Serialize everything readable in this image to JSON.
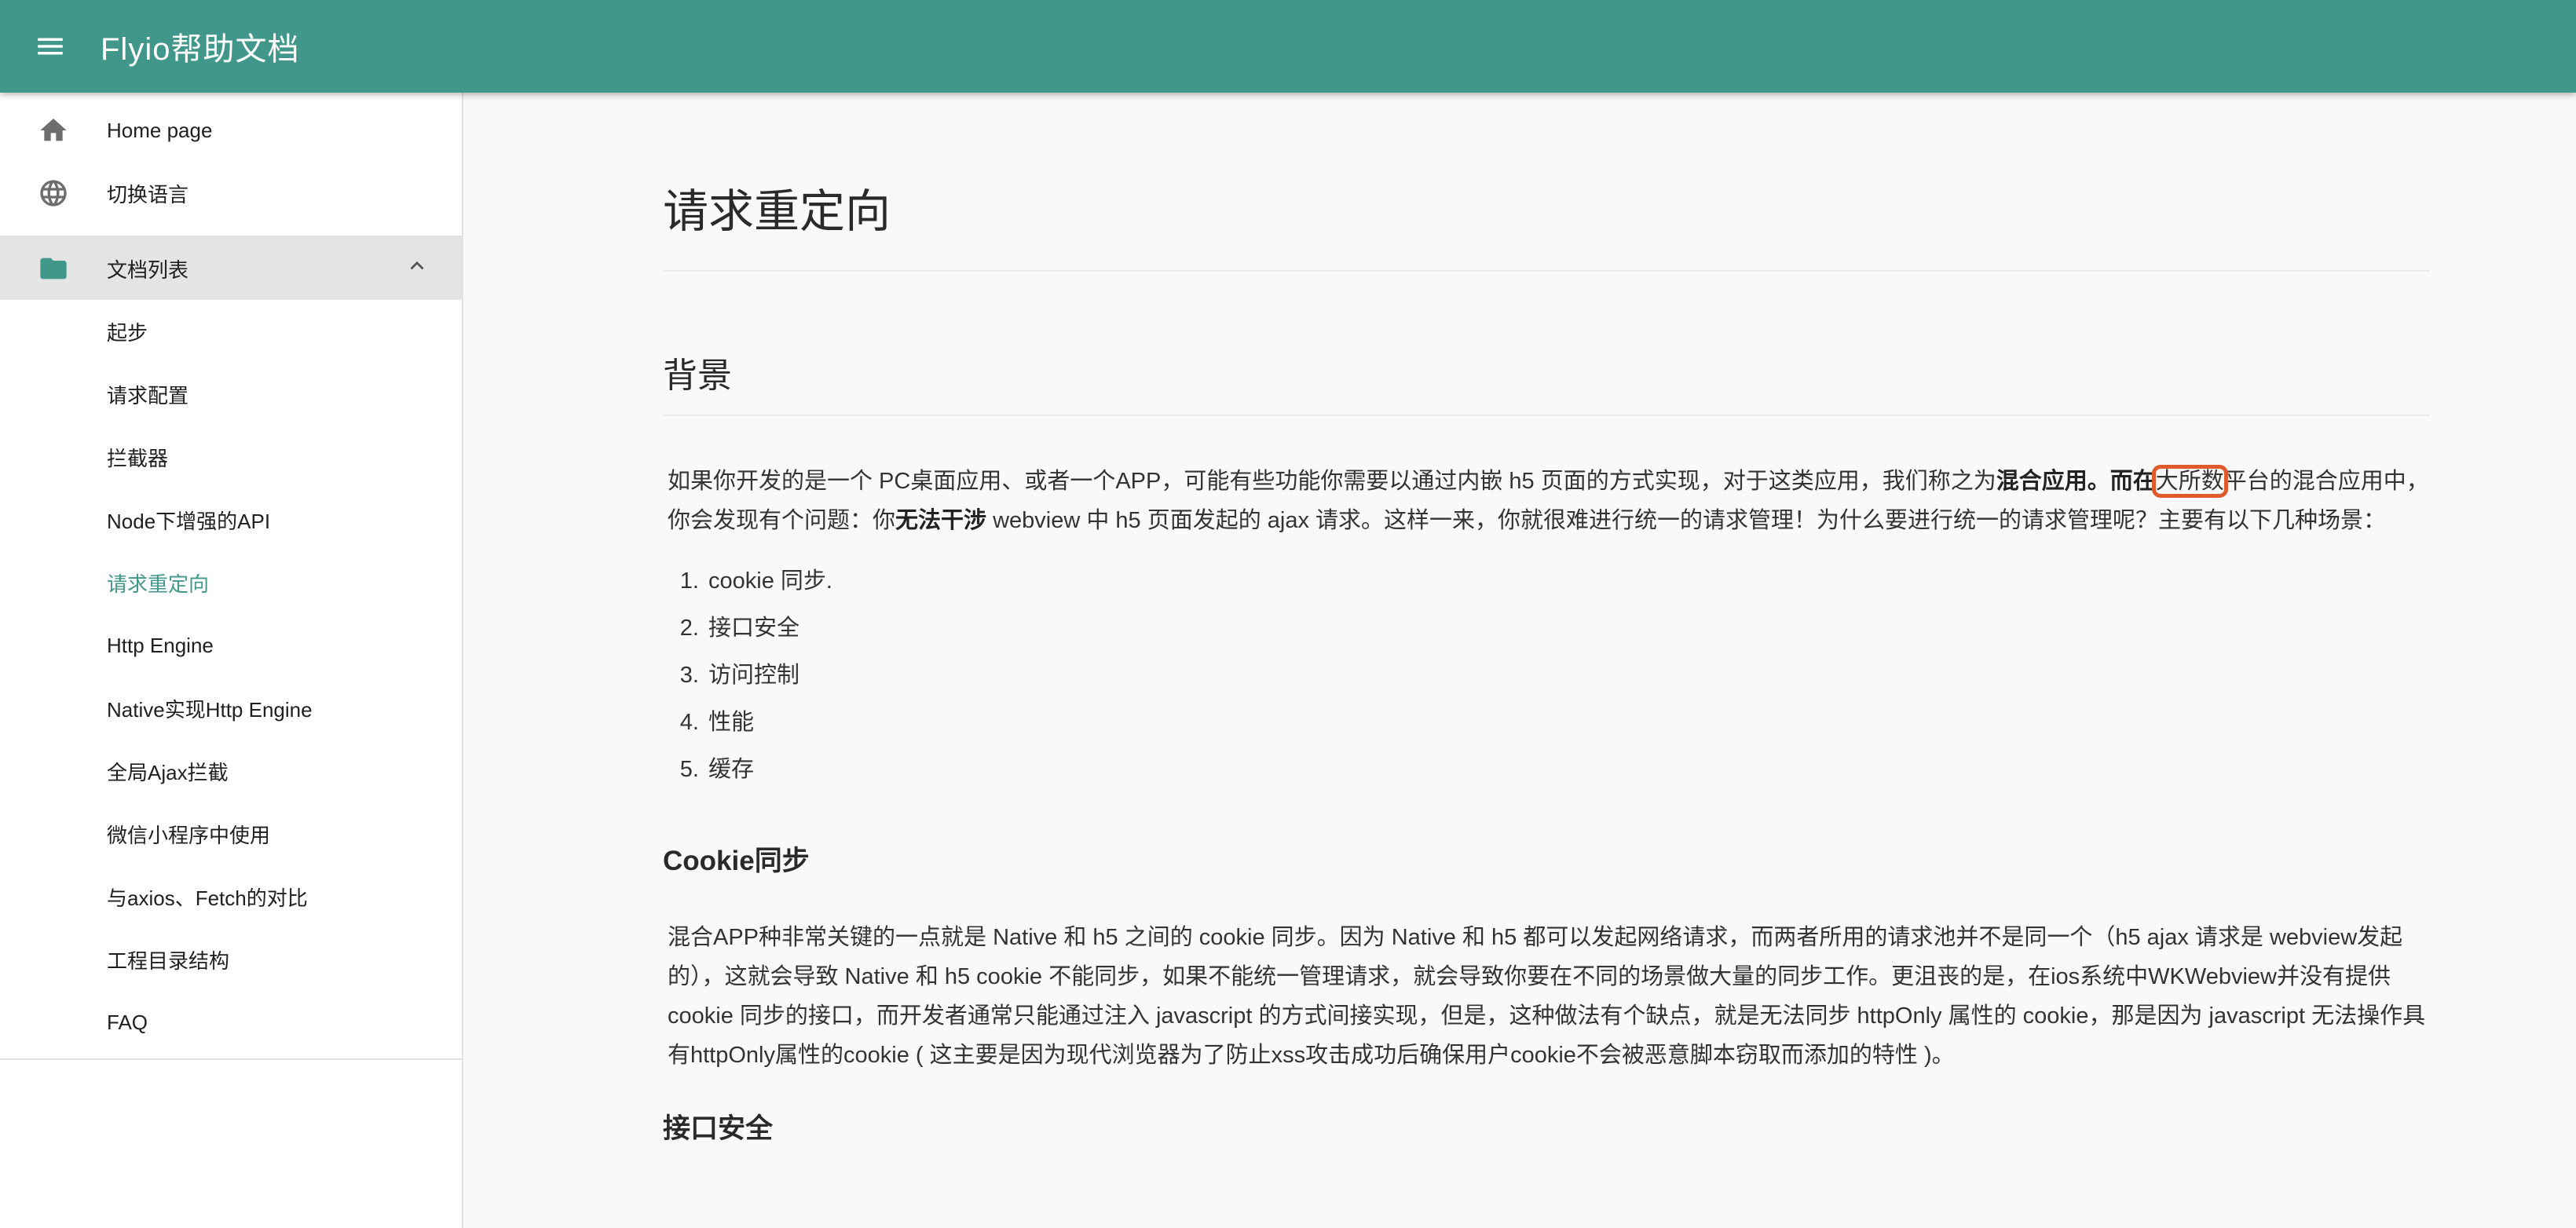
{
  "app": {
    "title": "Flyio帮助文档"
  },
  "sidebar": {
    "home": "Home page",
    "language": "切换语言",
    "group": "文档列表",
    "docs": [
      "起步",
      "请求配置",
      "拦截器",
      "Node下增强的API",
      "请求重定向",
      "Http Engine",
      "Native实现Http Engine",
      "全局Ajax拦截",
      "微信小程序中使用",
      "与axios、Fetch的对比",
      "工程目录结构",
      "FAQ"
    ],
    "active_doc": "请求重定向"
  },
  "article": {
    "title": "请求重定向",
    "background": {
      "heading": "背景",
      "p1_a": "如果你开发的是一个 PC桌面应用、或者一个APP，可能有些功能你需要以通过内嵌 h5 页面的方式实现，对于这类应用，我们称之为",
      "p1_bold1": "混合应用",
      "p1_b": "。而在",
      "p1_highlight": "大所数",
      "p1_c": "平台的混合应用中，你会发现有个问题：你",
      "p1_bold2": "无法干涉",
      "p1_d": " webview 中 h5 页面发起的 ajax 请求。这样一来，你就很难进行统一的请求管理！为什么要进行统一的请求管理呢？主要有以下几种场景：",
      "list": [
        "cookie 同步.",
        "接口安全",
        "访问控制",
        "性能",
        "缓存"
      ]
    },
    "cookie": {
      "heading": "Cookie同步",
      "p": "混合APP种非常关键的一点就是 Native 和 h5 之间的 cookie 同步。因为 Native 和 h5 都可以发起网络请求，而两者所用的请求池并不是同一个（h5 ajax 请求是 webview发起的），这就会导致 Native 和 h5 cookie 不能同步，如果不能统一管理请求，就会导致你要在不同的场景做大量的同步工作。更沮丧的是，在ios系统中WKWebview并没有提供 cookie 同步的接口，而开发者通常只能通过注入 javascript 的方式间接实现，但是，这种做法有个缺点，就是无法同步 httpOnly 属性的 cookie，那是因为 javascript 无法操作具有httpOnly属性的cookie ( 这主要是因为现代浏览器为了防止xss攻击成功后确保用户cookie不会被恶意脚本窃取而添加的特性 )。"
    },
    "security": {
      "heading": "接口安全"
    }
  }
}
